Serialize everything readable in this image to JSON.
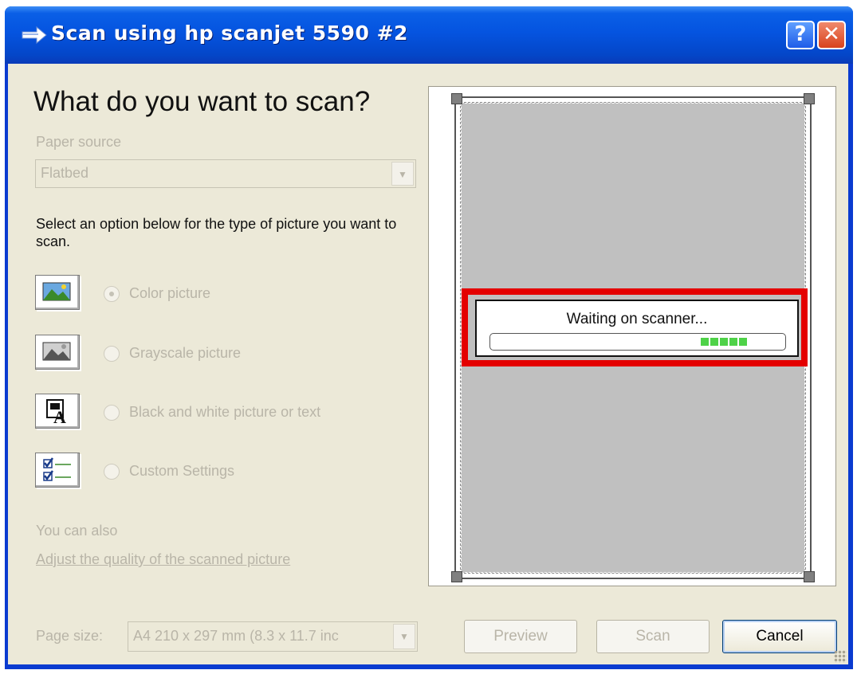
{
  "window": {
    "title": "Scan using hp scanjet 5590 #2",
    "help_button_label": "?",
    "close_button_label": "✕"
  },
  "left": {
    "heading": "What do you want to scan?",
    "paper_source_label": "Paper source",
    "paper_source_value": "Flatbed",
    "instructions": "Select an option below for the type of picture you want to scan.",
    "options": [
      {
        "label": "Color picture",
        "selected": true,
        "icon": "color-picture-icon"
      },
      {
        "label": "Grayscale picture",
        "selected": false,
        "icon": "grayscale-picture-icon"
      },
      {
        "label": "Black and white picture or text",
        "selected": false,
        "icon": "black-white-text-icon"
      },
      {
        "label": "Custom Settings",
        "selected": false,
        "icon": "custom-settings-icon"
      }
    ],
    "also_label": "You can also",
    "adjust_link": "Adjust the quality of the scanned picture",
    "page_size_label": "Page size:",
    "page_size_value": "A4 210 x 297 mm (8.3 x 11.7 inc"
  },
  "preview": {
    "status_text": "Waiting on scanner..."
  },
  "buttons": {
    "preview": "Preview",
    "scan": "Scan",
    "cancel": "Cancel"
  },
  "colors": {
    "titlebar": "#0554e0",
    "highlight": "#e40000",
    "progress_block": "#4ed248",
    "disabled_text": "#b9b5a8"
  }
}
